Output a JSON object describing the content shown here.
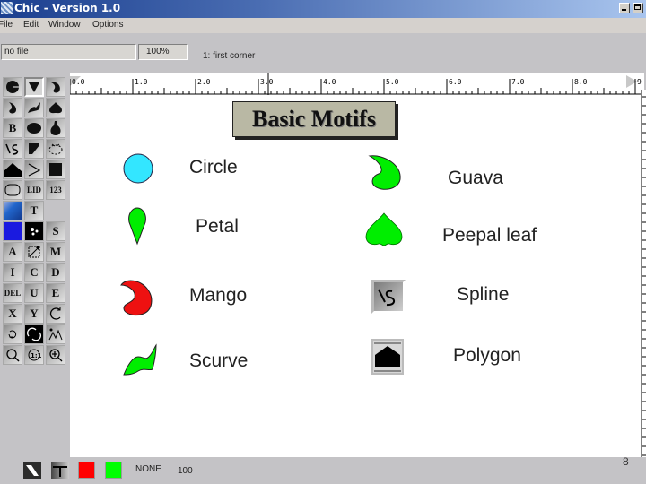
{
  "window": {
    "title": "Chic - Version 1.0",
    "minimize_label": "",
    "maximize_label": ""
  },
  "menu": [
    "File",
    "Edit",
    "Window",
    "Options"
  ],
  "toolbar": {
    "file_name": "no file",
    "zoom": "100%",
    "status_hint": "1: first corner"
  },
  "ruler": {
    "labels": [
      "0.0",
      "1.0",
      "2.0",
      "3.0",
      "4.0",
      "5.0",
      "6.0",
      "7.0",
      "8.0",
      "9"
    ]
  },
  "tools": [
    {
      "name": "circle-tool",
      "icon": "circle-icon"
    },
    {
      "name": "petal-tool",
      "icon": "petal-icon",
      "selected": true
    },
    {
      "name": "mango-tool",
      "icon": "mango-icon"
    },
    {
      "name": "guava-tool",
      "icon": "guava-icon"
    },
    {
      "name": "scurve-tool",
      "icon": "scurve-icon"
    },
    {
      "name": "peepal-tool",
      "icon": "peepal-leaf-icon"
    },
    {
      "name": "b-tool",
      "label": "B"
    },
    {
      "name": "ellipse-tool",
      "icon": "ellipse-icon"
    },
    {
      "name": "gourd-tool",
      "icon": "gourd-icon"
    },
    {
      "name": "spline-tool",
      "icon": "spline-icon"
    },
    {
      "name": "triangle-tool",
      "icon": "triangle-icon"
    },
    {
      "name": "dashed-shape-tool",
      "icon": "dashed-shape-icon"
    },
    {
      "name": "polygon-tool",
      "icon": "polygon-icon"
    },
    {
      "name": "polyline-tool",
      "icon": "polyline-icon"
    },
    {
      "name": "fill-rect-tool",
      "icon": "fill-rect-icon"
    },
    {
      "name": "rounded-rect-tool",
      "icon": "rounded-rect-icon"
    },
    {
      "name": "lid-tool",
      "label": "LID"
    },
    {
      "name": "sequence-tool",
      "label": "123"
    },
    {
      "name": "gradient-tool",
      "icon": "gradient-icon"
    },
    {
      "name": "text-tool",
      "label": "T"
    },
    {
      "name": "color-fill-tool",
      "icon": "blue-fill-icon"
    },
    {
      "name": "pattern-tool",
      "icon": "pattern-icon"
    },
    {
      "name": "s-tool",
      "label": "S"
    },
    {
      "name": "a-tool",
      "label": "A"
    },
    {
      "name": "resize-tool",
      "icon": "resize-icon"
    },
    {
      "name": "m-tool",
      "label": "M"
    },
    {
      "name": "i-tool",
      "label": "I"
    },
    {
      "name": "c-tool",
      "label": "C"
    },
    {
      "name": "d-tool",
      "label": "D"
    },
    {
      "name": "delete-tool",
      "label": "DEL"
    },
    {
      "name": "u-tool",
      "label": "U"
    },
    {
      "name": "e-tool",
      "label": "E"
    },
    {
      "name": "x-tool",
      "label": "X"
    },
    {
      "name": "y-tool",
      "label": "Y"
    },
    {
      "name": "rotate-ccw-tool",
      "icon": "rotate-icon"
    },
    {
      "name": "rotate-cw-tool",
      "icon": "rotate-small-icon"
    },
    {
      "name": "cycle-tool",
      "icon": "cycle-icon"
    },
    {
      "name": "scatter-tool",
      "icon": "scatter-icon"
    },
    {
      "name": "zoom-fit-tool",
      "icon": "zoom-fit-icon"
    },
    {
      "name": "zoom-reset-tool",
      "icon": "zoom-reset-icon"
    },
    {
      "name": "zoom-in-tool",
      "icon": "zoom-in-icon"
    },
    {
      "name": "zoom-tool",
      "icon": "magnifier-icon"
    }
  ],
  "slide": {
    "title": "Basic Motifs",
    "motifs": [
      {
        "label": "Circle",
        "icon": "circle-motif",
        "color": "#33e6ff"
      },
      {
        "label": "Guava",
        "icon": "guava-motif",
        "color": "#00ee00"
      },
      {
        "label": "Petal",
        "icon": "petal-motif",
        "color": "#00ee00"
      },
      {
        "label": "Peepal leaf",
        "icon": "peepal-leaf-motif",
        "color": "#00ee00"
      },
      {
        "label": "Mango",
        "icon": "mango-motif",
        "color": "#ee1111"
      },
      {
        "label": "Spline",
        "icon": "spline-tool-icon",
        "color": "#000000"
      },
      {
        "label": "Scurve",
        "icon": "scurve-motif",
        "color": "#00ee00"
      },
      {
        "label": "Polygon",
        "icon": "polygon-tool-icon",
        "color": "#000000"
      }
    ]
  },
  "bottom": {
    "line_color": "#ff0000",
    "fill_color": "#00ff00",
    "pattern": "NONE",
    "scale": "100",
    "page_number": "8"
  }
}
